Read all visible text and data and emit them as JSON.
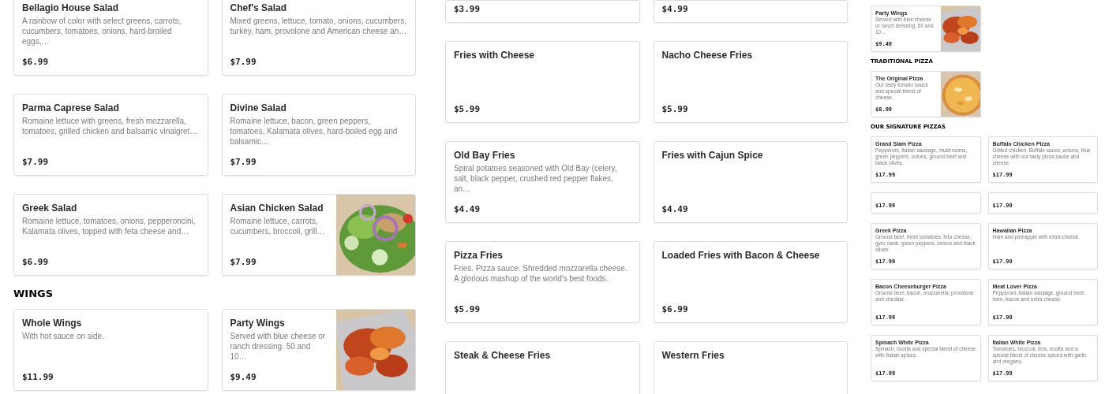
{
  "panels": [
    {
      "sections": [
        {
          "items": [
            {
              "kind": "plain",
              "name": "Bellagio House Salad",
              "description": "A rainbow of color with select greens, carrots, cucumbers, tomatoes, onions, hard-broiled eggs,…",
              "price": "$6.99"
            },
            {
              "kind": "plain",
              "name": "Chef's Salad",
              "description": "Mixed greens, lettuce, tomato, onions, cucumbers, turkey, ham, provolone and American cheese an…",
              "price": "$7.99"
            },
            {
              "kind": "plain",
              "name": "Parma Caprese Salad",
              "description": "Romaine lettuce with greens, fresh mozzarella, tomatoes, grilled chicken and balsamic vinaigret…",
              "price": "$7.99"
            },
            {
              "kind": "plain",
              "name": "Divine Salad",
              "description": "Romaine lettuce, bacon, green peppers, tomatoes, Kalamata olives, hard-boiled egg and balsamic…",
              "price": "$7.99"
            },
            {
              "kind": "plain",
              "name": "Greek Salad",
              "description": "Romaine lettuce, tomatoes, onions, pepperoncini, Kalamata olives, topped with feta cheese and…",
              "price": "$6.99"
            },
            {
              "kind": "picture",
              "name": "Asian Chicken Salad",
              "description": "Romaine lettuce, carrots, cucumbers, broccoli, grill…",
              "price": "$7.99"
            }
          ]
        },
        {
          "heading": "WINGS",
          "items": [
            {
              "kind": "plain",
              "name": "Whole Wings",
              "description": "With hot sauce on side.",
              "price": "$11.99"
            },
            {
              "kind": "picture",
              "name": "Party Wings",
              "description": "Served with blue cheese or ranch dressing. 50 and 10…",
              "price": "$9.49"
            }
          ]
        }
      ]
    },
    {
      "sections": [
        {
          "items": [
            {
              "kind": "plain",
              "price": "$3.99"
            },
            {
              "kind": "plain",
              "price": "$4.99"
            },
            {
              "kind": "plain",
              "name": "Fries with Cheese",
              "price": "$5.99"
            },
            {
              "kind": "plain",
              "name": "Nacho Cheese Fries",
              "price": "$5.99"
            },
            {
              "kind": "plain",
              "name": "Old Bay Fries",
              "description": "Spiral potatoes seasoned with Old Bay (celery, salt, black pepper, crushed red pepper flakes, an…",
              "price": "$4.49"
            },
            {
              "kind": "plain",
              "name": "Fries with Cajun Spice",
              "price": "$4.49"
            },
            {
              "kind": "plain",
              "name": "Pizza Fries",
              "description": "Fries. Pizza sauce. Shredded mozzarella cheese. A glorious mashup of the world's best foods.",
              "price": "$5.99"
            },
            {
              "kind": "plain",
              "name": "Loaded Fries with Bacon & Cheese",
              "price": "$6.99"
            },
            {
              "kind": "plain",
              "name": "Steak & Cheese Fries"
            },
            {
              "kind": "plain",
              "name": "Western Fries"
            }
          ]
        }
      ]
    },
    {
      "sections": [
        {
          "items": [
            {
              "kind": "picture",
              "name": "Party Wings",
              "description": "Served with blue cheese or ranch dressing. 50 and 10…",
              "price": "$9.49"
            }
          ]
        },
        {
          "heading": "TRADITIONAL PIZZA",
          "items": [
            {
              "kind": "picture",
              "name": "The Original Pizza",
              "description": "Our tasty tomato sauce and special blend of cheese.",
              "price": "$8.99"
            }
          ]
        },
        {
          "heading": "OUR SIGNATURE PIZZAS",
          "items": [
            {
              "kind": "plain",
              "name": "Grand Slam Pizza",
              "description": "Pepperoni, Italian sausage, mushrooms, green peppers, onions, ground beef and black olives.",
              "price": "$17.99"
            },
            {
              "kind": "plain",
              "name": "Buffalo Chicken Pizza",
              "description": "Grilled chicken, Buffalo sauce, onions, blue cheese with our tasty pizza sauce and cheese.",
              "price": "$17.99"
            },
            {
              "kind": "plain",
              "price": "$17.99"
            },
            {
              "kind": "plain",
              "price": "$17.99"
            },
            {
              "kind": "plain",
              "name": "Greek Pizza",
              "description": "Ground beef, fresh tomatoes, feta cheese, gyro meat, green peppers, onions and black olives.",
              "price": "$17.99"
            },
            {
              "kind": "plain",
              "name": "Hawaiian Pizza",
              "description": "Ham and pineapple with extra cheese.",
              "price": "$17.99"
            },
            {
              "kind": "plain",
              "name": "Bacon Cheeseburger Pizza",
              "description": "Ground beef, bacon, mozzarella, provolone and cheddar.",
              "price": "$17.99"
            },
            {
              "kind": "plain",
              "name": "Meat Lover Pizza",
              "description": "Pepperoni, Italian sausage, ground beef, ham, bacon and extra cheese.",
              "price": "$17.99"
            },
            {
              "kind": "plain",
              "name": "Spinach White Pizza",
              "description": "Spinach, ricotta and special blend of cheese with Italian spices.",
              "price": "$17.99"
            },
            {
              "kind": "plain",
              "name": "Italian White Pizza",
              "description": "Tomatoes, broccoli, feta, ricotta and a special blend of cheese spiced with garlic and oregano.",
              "price": "$17.99"
            }
          ]
        }
      ]
    }
  ]
}
